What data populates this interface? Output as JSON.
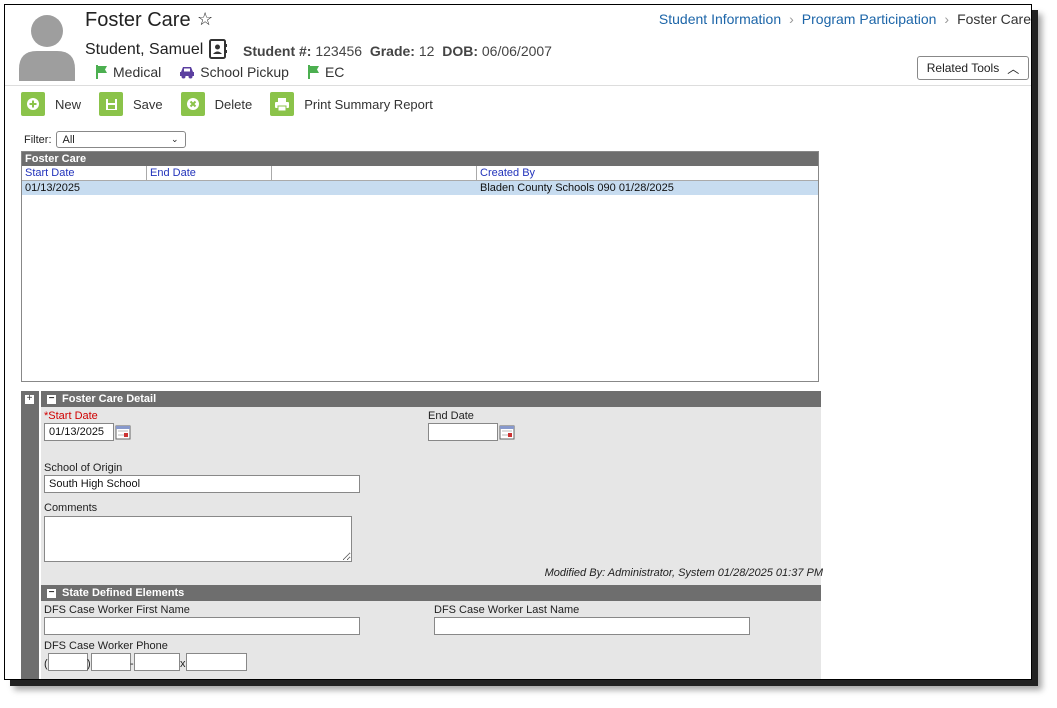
{
  "header": {
    "title": "Foster Care",
    "breadcrumb": [
      "Student Information",
      "Program Participation",
      "Foster Care"
    ],
    "student_name": "Student, Samuel",
    "student_num_label": "Student #:",
    "student_num": "123456",
    "grade_label": "Grade:",
    "grade": "12",
    "dob_label": "DOB:",
    "dob": "06/06/2007",
    "flags": [
      {
        "label": "Medical",
        "icon": "flag-icon",
        "color": "#4caf50"
      },
      {
        "label": "School Pickup",
        "icon": "car-icon",
        "color": "#5b3fa0"
      },
      {
        "label": "EC",
        "icon": "flag-icon",
        "color": "#4caf50"
      }
    ],
    "related_tools": "Related Tools"
  },
  "toolbar": {
    "new": "New",
    "save": "Save",
    "delete": "Delete",
    "print": "Print Summary Report"
  },
  "filter": {
    "label": "Filter:",
    "value": "All"
  },
  "grid": {
    "title": "Foster Care",
    "columns": [
      "Start Date",
      "End Date",
      "",
      "Created By"
    ],
    "rows": [
      [
        "01/13/2025",
        "",
        "",
        "Bladen County Schools 090 01/28/2025"
      ]
    ]
  },
  "detail": {
    "title": "Foster Care Detail",
    "start_date_label": "Start Date",
    "start_date": "01/13/2025",
    "end_date_label": "End Date",
    "end_date": "",
    "school_label": "School of Origin",
    "school": "South High School",
    "comments_label": "Comments",
    "comments": "",
    "modified": "Modified By: Administrator, System 01/28/2025 01:37 PM"
  },
  "state": {
    "title": "State Defined Elements",
    "first_name_label": "DFS Case Worker First Name",
    "last_name_label": "DFS Case Worker Last Name",
    "phone_label": "DFS Case Worker Phone"
  },
  "colors": {
    "accent": "#8bc34a",
    "link": "#1c65a8",
    "header_bar": "#6e6e6e",
    "selected_row": "#c7dcf0"
  }
}
